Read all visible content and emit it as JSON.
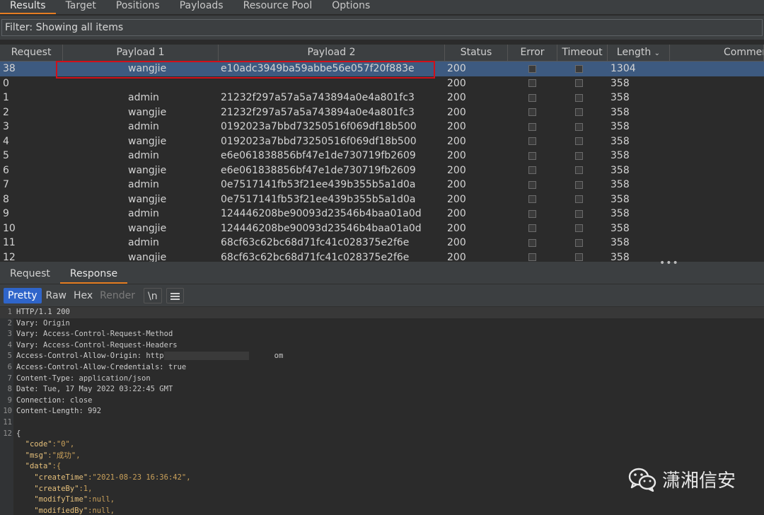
{
  "top_tabs": [
    "Results",
    "Target",
    "Positions",
    "Payloads",
    "Resource Pool",
    "Options"
  ],
  "filter": {
    "text": "Filter: Showing all items"
  },
  "table": {
    "columns": [
      "Request",
      "Payload 1",
      "Payload 2",
      "Status",
      "Error",
      "Timeout",
      "Length",
      "Comment"
    ],
    "sort_column": "Length",
    "rows": [
      {
        "request": "38",
        "payload1": "wangjie",
        "payload2": "e10adc3949ba59abbe56e057f20f883e",
        "status": "200",
        "length": "1304"
      },
      {
        "request": "0",
        "payload1": "",
        "payload2": "",
        "status": "200",
        "length": "358"
      },
      {
        "request": "1",
        "payload1": "admin",
        "payload2": "21232f297a57a5a743894a0e4a801fc3",
        "status": "200",
        "length": "358"
      },
      {
        "request": "2",
        "payload1": "wangjie",
        "payload2": "21232f297a57a5a743894a0e4a801fc3",
        "status": "200",
        "length": "358"
      },
      {
        "request": "3",
        "payload1": "admin",
        "payload2": "0192023a7bbd73250516f069df18b500",
        "status": "200",
        "length": "358"
      },
      {
        "request": "4",
        "payload1": "wangjie",
        "payload2": "0192023a7bbd73250516f069df18b500",
        "status": "200",
        "length": "358"
      },
      {
        "request": "5",
        "payload1": "admin",
        "payload2": "e6e061838856bf47e1de730719fb2609",
        "status": "200",
        "length": "358"
      },
      {
        "request": "6",
        "payload1": "wangjie",
        "payload2": "e6e061838856bf47e1de730719fb2609",
        "status": "200",
        "length": "358"
      },
      {
        "request": "7",
        "payload1": "admin",
        "payload2": "0e7517141fb53f21ee439b355b5a1d0a",
        "status": "200",
        "length": "358"
      },
      {
        "request": "8",
        "payload1": "wangjie",
        "payload2": "0e7517141fb53f21ee439b355b5a1d0a",
        "status": "200",
        "length": "358"
      },
      {
        "request": "9",
        "payload1": "admin",
        "payload2": "124446208be90093d23546b4baa01a0d",
        "status": "200",
        "length": "358"
      },
      {
        "request": "10",
        "payload1": "wangjie",
        "payload2": "124446208be90093d23546b4baa01a0d",
        "status": "200",
        "length": "358"
      },
      {
        "request": "11",
        "payload1": "admin",
        "payload2": "68cf63c62bc68d71fc41c028375e2f6e",
        "status": "200",
        "length": "358"
      },
      {
        "request": "12",
        "payload1": "wangjie",
        "payload2": "68cf63c62bc68d71fc41c028375e2f6e",
        "status": "200",
        "length": "358"
      }
    ]
  },
  "sub_tabs": [
    "Request",
    "Response"
  ],
  "toolbar": {
    "pretty": "Pretty",
    "raw": "Raw",
    "hex": "Hex",
    "render": "Render",
    "newline": "\\n"
  },
  "response_lines": [
    {
      "n": "1",
      "key": "HTTP/1.1 200",
      "val": ""
    },
    {
      "n": "2",
      "key": "Vary",
      "val": ": Origin"
    },
    {
      "n": "3",
      "key": "Vary",
      "val": ": Access-Control-Request-Method"
    },
    {
      "n": "4",
      "key": "Vary",
      "val": ": Access-Control-Request-Headers"
    },
    {
      "n": "5",
      "key": "Access-Control-Allow-Origin",
      "val": ": http",
      "tail": "om"
    },
    {
      "n": "6",
      "key": "Access-Control-Allow-Credentials",
      "val": ": true"
    },
    {
      "n": "7",
      "key": "Content-Type",
      "val": ": application/json"
    },
    {
      "n": "8",
      "key": "Date",
      "val": ": Tue, 17 May 2022 03:22:45 GMT"
    },
    {
      "n": "9",
      "key": "Connection",
      "val": ": close"
    },
    {
      "n": "10",
      "key": "Content-Length",
      "val": ": 992"
    },
    {
      "n": "11",
      "key": "",
      "val": ""
    },
    {
      "n": "12",
      "key": "{",
      "val": ""
    }
  ],
  "json_lines": [
    {
      "indent": "  ",
      "key": "\"code\"",
      "val": ":\"0\","
    },
    {
      "indent": "  ",
      "key": "\"msg\"",
      "val": ":\"成功\","
    },
    {
      "indent": "  ",
      "key": "\"data\"",
      "val": ":{"
    },
    {
      "indent": "    ",
      "key": "\"createTime\"",
      "val": ":\"2021-08-23 16:36:42\","
    },
    {
      "indent": "    ",
      "key": "\"createBy\"",
      "val": ":1,"
    },
    {
      "indent": "    ",
      "key": "\"modifyTime\"",
      "val": ":null,"
    },
    {
      "indent": "    ",
      "key": "\"modifiedBy\"",
      "val": ":null,"
    }
  ],
  "watermark": {
    "text": "潇湘信安",
    "icon": "wechat-icon"
  },
  "colors": {
    "accent": "#e67e22",
    "selected_row": "#3d5a80",
    "highlight": "#d0101a",
    "active_button": "#2f65ca"
  }
}
